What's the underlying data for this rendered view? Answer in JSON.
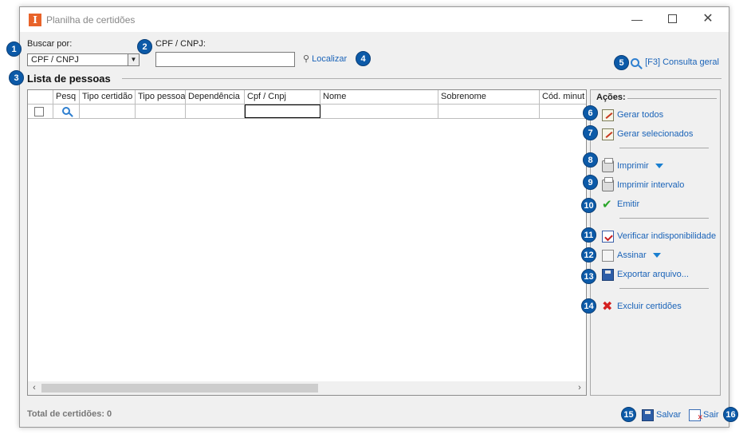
{
  "window": {
    "title": "Planilha de certidões",
    "app_icon": "I",
    "controls": {
      "minimize": "—",
      "maximize": "",
      "close": "✕"
    }
  },
  "search": {
    "buscar_label": "Buscar por:",
    "buscar_value": "CPF / CNPJ",
    "cpf_label": "CPF / CNPJ:",
    "cpf_value": "",
    "localizar_label": "Localizar",
    "consulta_label": "[F3] Consulta geral"
  },
  "list": {
    "title": "Lista de pessoas",
    "columns": [
      "",
      "Pesq",
      "Tipo certidão",
      "Tipo pessoa",
      "Dependência",
      "Cpf / Cnpj",
      "Nome",
      "Sobrenome",
      "Cód. minut"
    ],
    "rows": [
      [
        "",
        "",
        "",
        "",
        "",
        "",
        "",
        "",
        ""
      ]
    ]
  },
  "actions": {
    "title": "Ações:",
    "gerar_todos": "Gerar todos",
    "gerar_selecionados": "Gerar selecionados",
    "imprimir": "Imprimir",
    "imprimir_intervalo": "Imprimir intervalo",
    "emitir": "Emitir",
    "verificar": "Verificar indisponibilidade",
    "assinar": "Assinar",
    "exportar": "Exportar arquivo...",
    "excluir": "Excluir certidões"
  },
  "footer": {
    "total": "Total de certidões: 0",
    "salvar": "Salvar",
    "sair": "Sair"
  },
  "badges": [
    "1",
    "2",
    "3",
    "4",
    "5",
    "6",
    "7",
    "8",
    "9",
    "10",
    "11",
    "12",
    "13",
    "14",
    "15",
    "16"
  ],
  "colors": {
    "badge": "#0c5aa8",
    "link": "#1a63b8",
    "app_icon": "#e8632a"
  }
}
